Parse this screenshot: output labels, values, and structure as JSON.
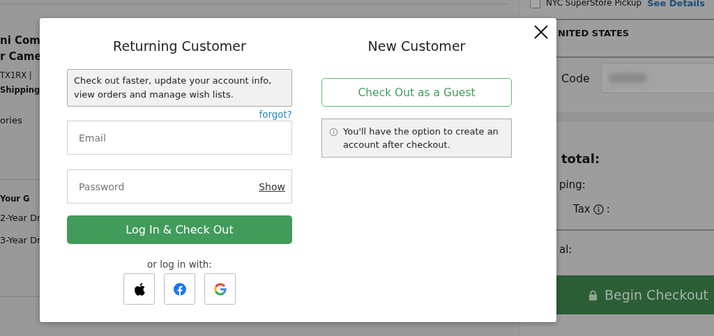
{
  "cart": {
    "sections": [
      [
        {
          "text": "ni Com",
          "kind": "title"
        },
        {
          "text": "r Came",
          "kind": "title"
        },
        {
          "text": "TX1RX |",
          "kind": "meta"
        },
        {
          "text": "Shipping",
          "kind": "bold"
        },
        {
          "text": "ories",
          "kind": "plain"
        }
      ],
      [
        {
          "text": "Your G",
          "kind": "bold"
        },
        {
          "text": "2-Year Dr",
          "kind": "plain"
        },
        {
          "text": "3-Year Dr",
          "kind": "plain"
        }
      ]
    ]
  },
  "summary": {
    "pickup_label": "NYC SuperStore Pickup",
    "pickup_checked": false,
    "see_details": "See Details",
    "country": "NITED STATES",
    "code_label": "Code",
    "subtotal_label": "total:",
    "shipping_label": "ping:",
    "tax_label": "Tax",
    "tax_suffix": ":",
    "total_label": "al:",
    "checkout_button": "Begin Checkout"
  },
  "modal": {
    "returning": {
      "title": "Returning Customer",
      "info": "Check out faster, update your account info, view orders and manage wish lists.",
      "forgot": "forgot?",
      "email_placeholder": "Email",
      "password_placeholder": "Password",
      "show": "Show",
      "login_button": "Log In & Check Out",
      "alt_login": "or log in with:",
      "providers": [
        {
          "kind": "apple"
        },
        {
          "kind": "facebook"
        },
        {
          "kind": "google"
        }
      ]
    },
    "new": {
      "title": "New Customer",
      "guest_button": "Check Out as a Guest",
      "note": "You'll have the option to create an account after checkout."
    }
  }
}
